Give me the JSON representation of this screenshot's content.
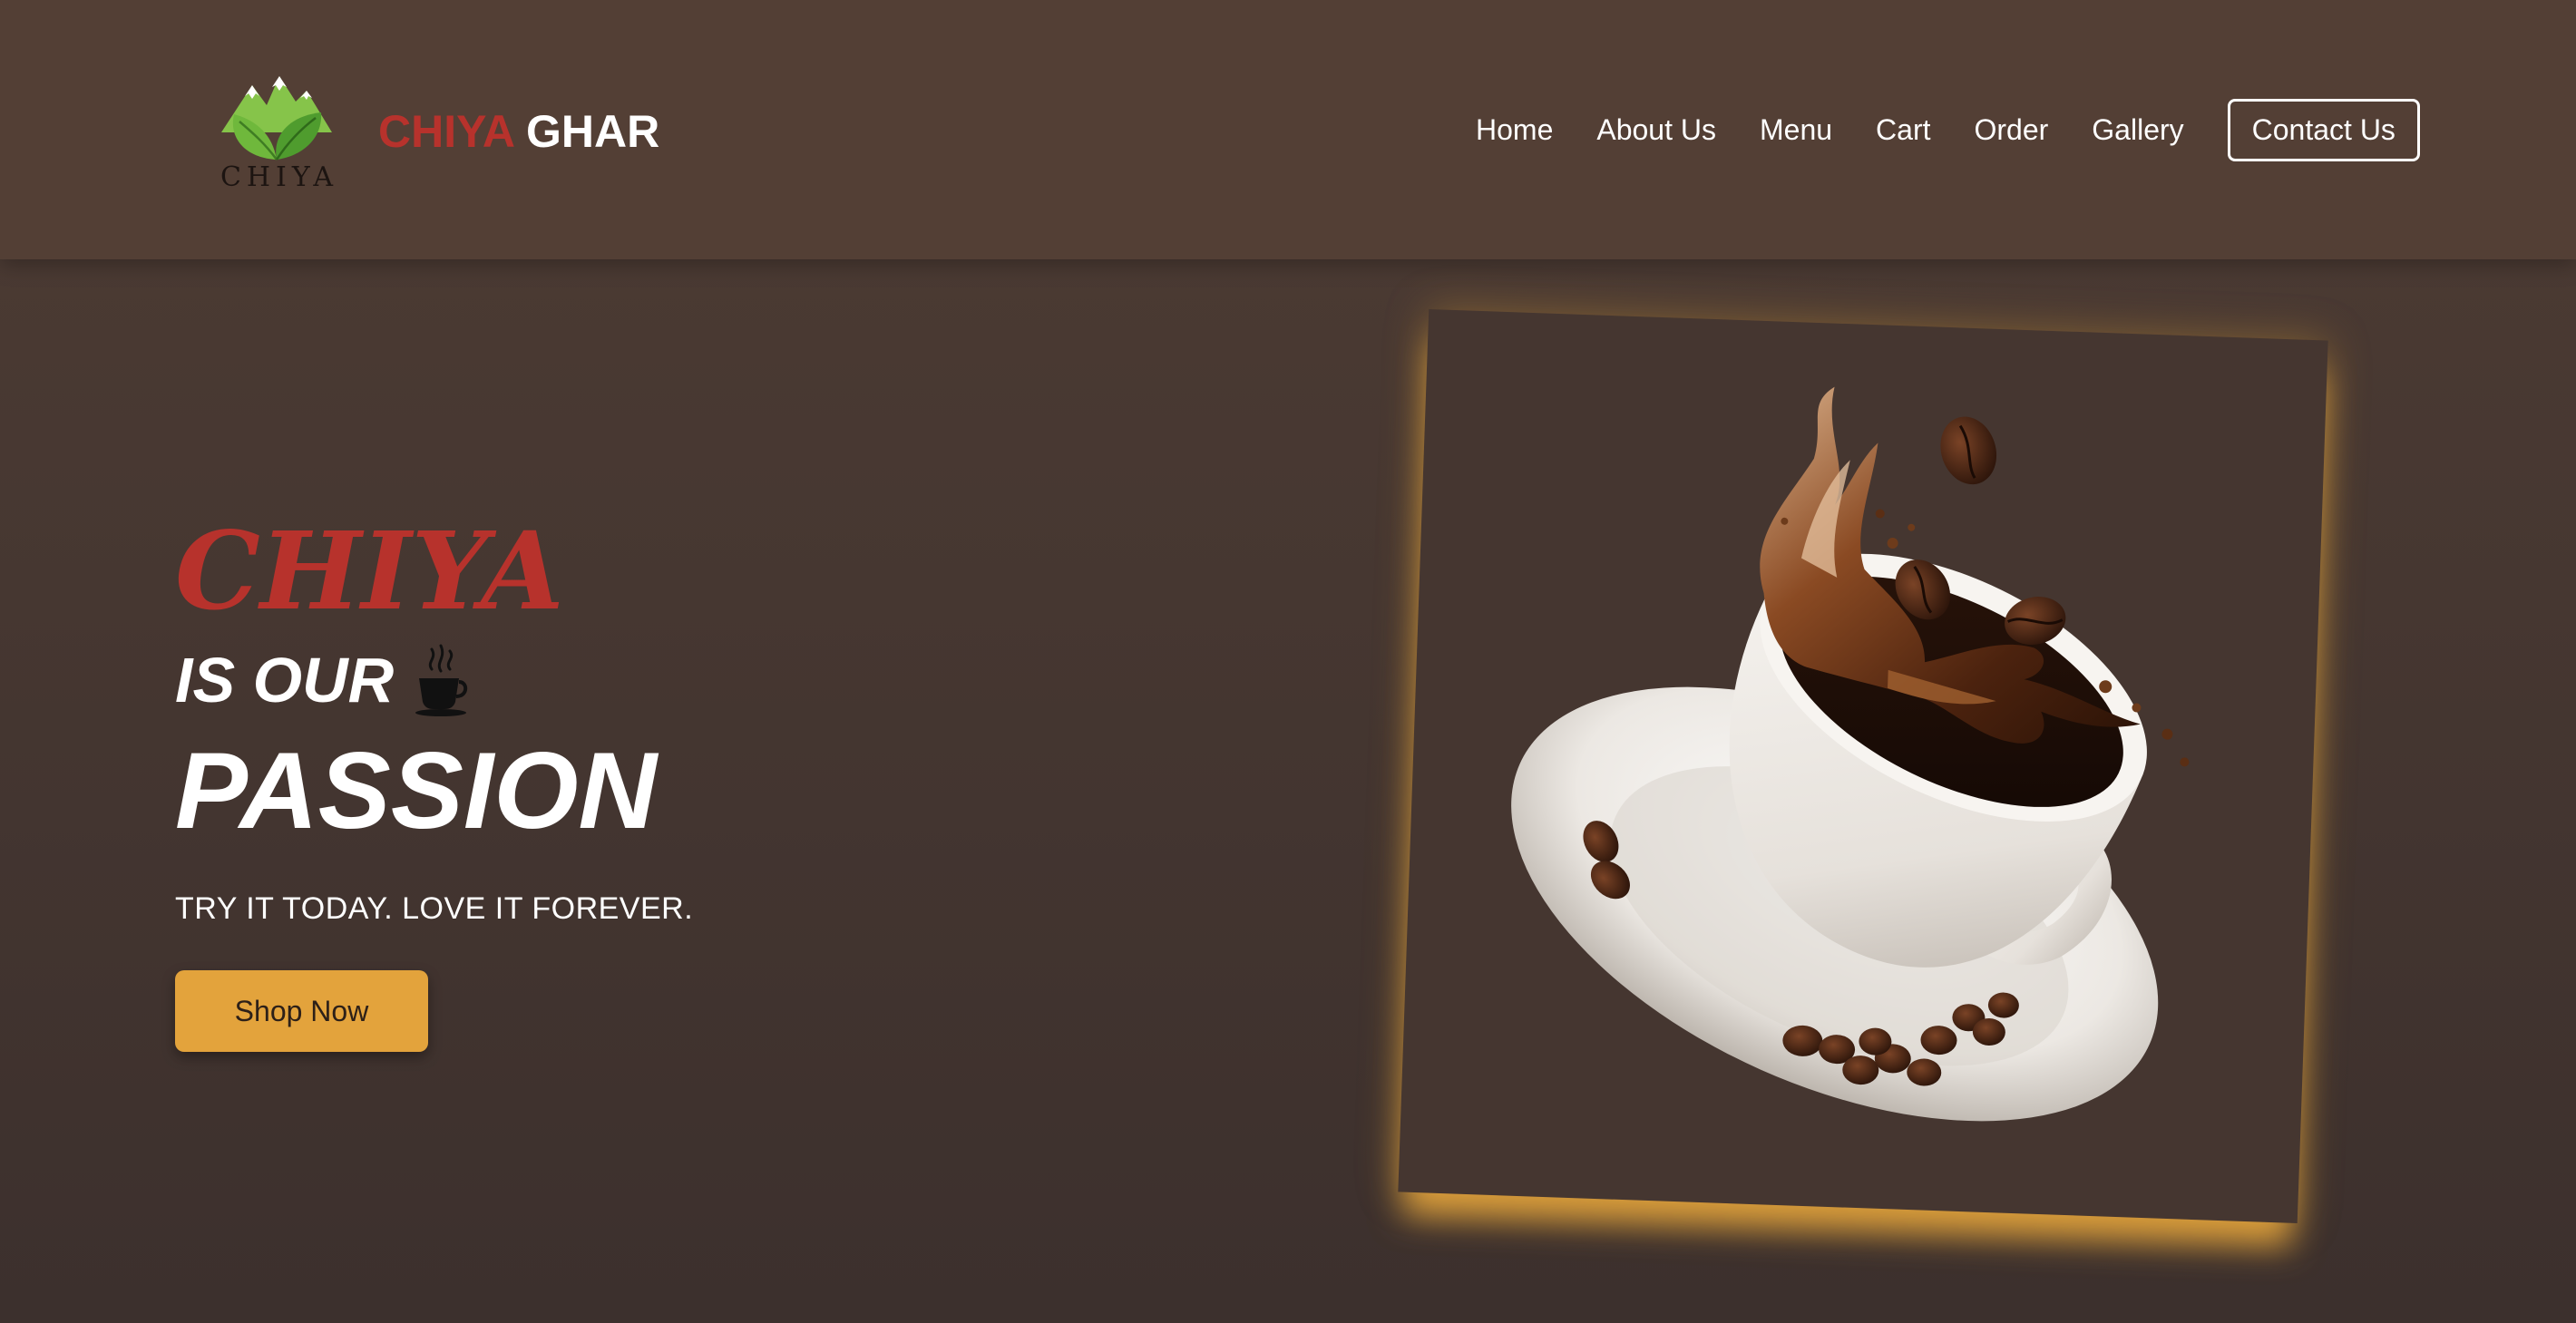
{
  "header": {
    "logo_text": "CHIYA",
    "brand_part1": "CHIYA",
    "brand_part2": "GHAR",
    "nav": {
      "home": "Home",
      "about": "About Us",
      "menu": "Menu",
      "cart": "Cart",
      "order": "Order",
      "gallery": "Gallery",
      "contact": "Contact Us"
    }
  },
  "hero": {
    "title_line1": "CHIYA",
    "title_line2": "IS OUR",
    "title_line3": "PASSION",
    "subtitle": "TRY IT TODAY. LOVE IT FOREVER.",
    "cta_label": "Shop Now",
    "cup_icon": "hot-coffee-cup-icon",
    "image": "coffee-cup-splash-with-beans"
  },
  "colors": {
    "background": "#48382f",
    "header": "#533f35",
    "brand_red": "#b7322c",
    "accent_gold": "#e3a33c",
    "text_white": "#ffffff"
  }
}
